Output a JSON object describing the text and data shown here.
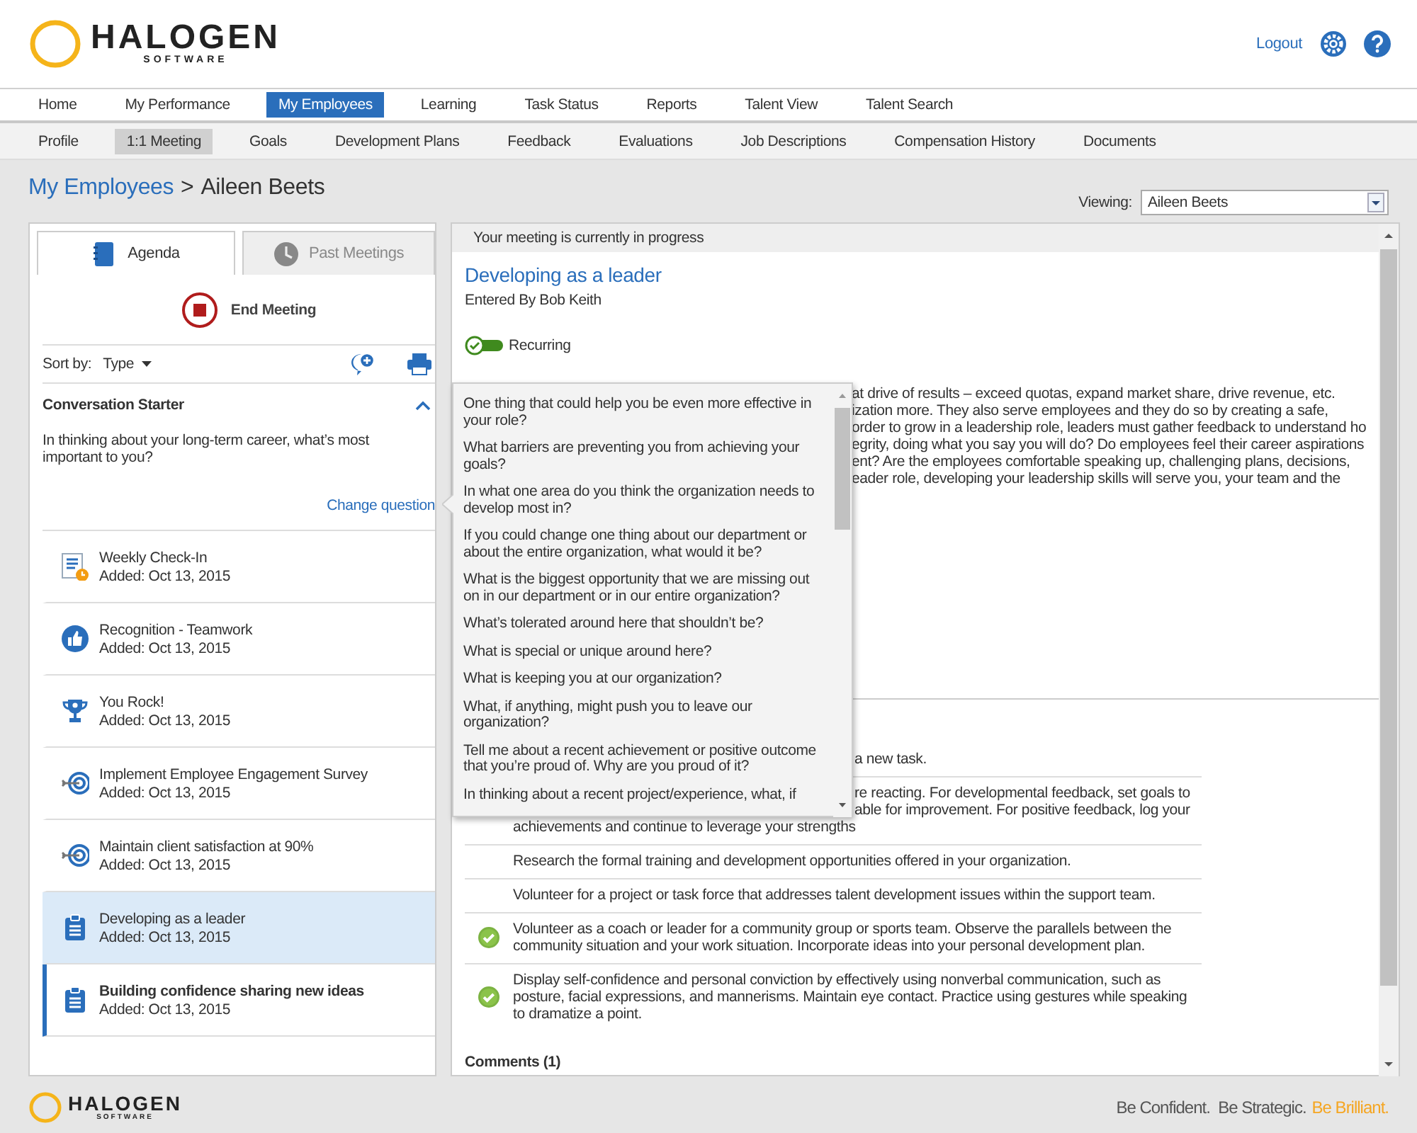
{
  "header": {
    "logo": {
      "brand": "HALOGEN",
      "sub": "SOFTWARE"
    },
    "logout": "Logout"
  },
  "main_nav": [
    {
      "label": "Home",
      "selected": false
    },
    {
      "label": "My Performance",
      "selected": false
    },
    {
      "label": "My Employees",
      "selected": true
    },
    {
      "label": "Learning",
      "selected": false
    },
    {
      "label": "Task Status",
      "selected": false
    },
    {
      "label": "Reports",
      "selected": false
    },
    {
      "label": "Talent View",
      "selected": false
    },
    {
      "label": "Talent Search",
      "selected": false
    }
  ],
  "sub_nav": [
    {
      "label": "Profile",
      "selected": false
    },
    {
      "label": "1:1 Meeting",
      "selected": true
    },
    {
      "label": "Goals",
      "selected": false
    },
    {
      "label": "Development Plans",
      "selected": false
    },
    {
      "label": "Feedback",
      "selected": false
    },
    {
      "label": "Evaluations",
      "selected": false
    },
    {
      "label": "Job Descriptions",
      "selected": false
    },
    {
      "label": "Compensation History",
      "selected": false
    },
    {
      "label": "Documents",
      "selected": false
    }
  ],
  "breadcrumb": {
    "parent": "My Employees",
    "separator": ">",
    "current": "Aileen Beets"
  },
  "viewing": {
    "label": "Viewing:",
    "value": "Aileen Beets"
  },
  "left_panel": {
    "tabs": [
      {
        "label": "Agenda",
        "kind": "agenda",
        "selected": true
      },
      {
        "label": "Past Meetings",
        "kind": "history",
        "selected": false
      }
    ],
    "end_meeting": "End Meeting",
    "sort": {
      "label": "Sort by:",
      "value": "Type"
    },
    "conversation_starter": {
      "title": "Conversation Starter",
      "expanded": true,
      "question": "In thinking about your long-term career, what’s most important to you?",
      "change_link": "Change question",
      "question_menu": [
        "One thing that could help you be even more effective in your role?",
        "What barriers are preventing you from achieving your goals?",
        "In what one area do you think the organization needs to develop most in?",
        "If you could change one thing about our department or about the entire organization, what would it be?",
        "What is the biggest opportunity that we are missing out on in our department or in our entire organization?",
        "What’s tolerated around here that shouldn’t be?",
        "What is special or unique around here?",
        "What is keeping you at our organization?",
        "What, if anything, might push you to leave our organization?",
        "Tell me about a recent achievement or positive outcome that you’re proud of. Why are you proud of it?",
        "In thinking about a recent project/experience, what, if"
      ]
    },
    "agenda_items": [
      {
        "kind": "checkin",
        "title": "Weekly Check-In",
        "added": "Added: Oct 13, 2015",
        "selected": false,
        "unread": false
      },
      {
        "kind": "recognition",
        "title": "Recognition - Teamwork",
        "added": "Added: Oct 13, 2015",
        "selected": false,
        "unread": false
      },
      {
        "kind": "award",
        "title": "You Rock!",
        "added": "Added: Oct 13, 2015",
        "selected": false,
        "unread": false
      },
      {
        "kind": "goal",
        "title": "Implement Employee Engagement Survey",
        "added": "Added: Oct 13, 2015",
        "selected": false,
        "unread": false
      },
      {
        "kind": "goal",
        "title": "Maintain client satisfaction at 90%",
        "added": "Added: Oct 13, 2015",
        "selected": false,
        "unread": false
      },
      {
        "kind": "plan",
        "title": "Developing as a leader",
        "added": "Added: Oct 13, 2015",
        "selected": true,
        "unread": false
      },
      {
        "kind": "plan",
        "title": "Building confidence sharing new ideas",
        "added": "Added: Oct 13, 2015",
        "selected": false,
        "unread": true
      }
    ]
  },
  "right_panel": {
    "status": "Your meeting is currently in progress",
    "title": "Developing as a leader",
    "entered_by": "Entered By Bob Keith",
    "recurring": {
      "label": "Recurring",
      "on": true
    },
    "description_lines": [
      {
        "text": "at drive of results – exceed quotas, expand market share, drive revenue, etc.",
        "covered": true
      },
      {
        "text": "ization more. They also serve employees and they do so by creating a safe,",
        "covered": true
      },
      {
        "text": "order to grow in a leadership role, leaders must gather feedback to understand ho",
        "covered": true
      },
      {
        "text": "egrity, doing what you say you will do? Do employees feel their career aspirations",
        "covered": true
      },
      {
        "text": "ent? Are the employees comfortable speaking up, challenging plans, decisions,",
        "covered": true
      },
      {
        "text": "eader role, developing your leadership skills will serve you, your team and the",
        "covered": true
      }
    ],
    "tasks": [
      {
        "done": false,
        "lines": [
          {
            "text": "a new task.",
            "covered": true
          }
        ]
      },
      {
        "done": false,
        "lines": [
          {
            "text": "re reacting. For developmental feedback, set goals to",
            "covered": true
          },
          {
            "text": "able for improvement. For positive feedback, log your",
            "covered": true
          },
          {
            "text": "achievements and continue to leverage your strengths",
            "covered": false
          }
        ]
      },
      {
        "done": false,
        "text": "Research the formal training and development opportunities offered in your organization."
      },
      {
        "done": false,
        "text": "Volunteer for a project or task force that addresses talent development issues within the support team."
      },
      {
        "done": true,
        "text": "Volunteer as a coach or leader for a community group or sports team. Observe the parallels between the community situation and your work situation. Incorporate ideas into your personal development plan."
      },
      {
        "done": true,
        "text": "Display self-confidence and personal conviction by effectively using nonverbal communication, such as posture, facial expressions, and mannerisms. Maintain eye contact. Practice using gestures while speaking to dramatize a point."
      }
    ],
    "comments": "Comments (1)"
  },
  "footer": {
    "logo": {
      "brand": "HALOGEN",
      "sub": "SOFTWARE"
    },
    "tagline": "Be Confident.  Be Strategic.",
    "tagline_accent": "Be Brilliant."
  }
}
